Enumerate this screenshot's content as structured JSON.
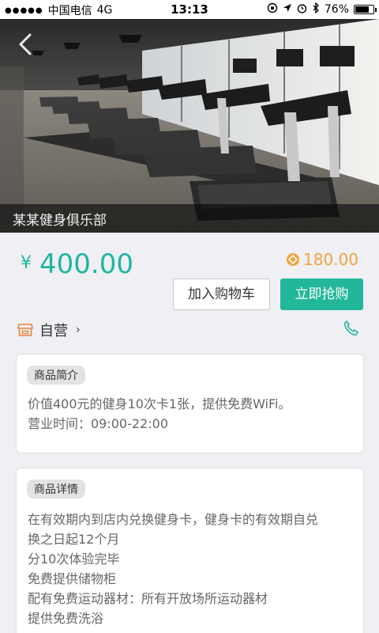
{
  "status_bar": {
    "carrier": "中国电信",
    "network": "4G",
    "time": "13:13",
    "battery": "76%",
    "battery_level": 0.76
  },
  "hero": {
    "club_name": "某某健身俱乐部"
  },
  "price": {
    "currency": "¥",
    "amount": "400.00",
    "points": "180.00"
  },
  "buttons": {
    "add_to_cart": "加入购物车",
    "buy_now": "立即抢购"
  },
  "store": {
    "label": "自营",
    "chevron": "›"
  },
  "intro": {
    "tag": "商品简介",
    "lines": [
      "价值400元的健身10次卡1张，提供免费WiFi。",
      "营业时间：09:00-22:00"
    ]
  },
  "detail": {
    "tag": "商品详情",
    "lines": [
      "在有效期内到店内兑换健身卡，健身卡的有效期自兑",
      "换之日起12个月",
      "分10次体验完毕",
      "免费提供储物柜",
      "配有免费运动器材：所有开放场所运动器材",
      "提供免费洗浴"
    ]
  },
  "colors": {
    "accent": "#22b79b",
    "price": "#1fb6a0",
    "points": "#f2a33c",
    "store_icon": "#e8823a"
  }
}
